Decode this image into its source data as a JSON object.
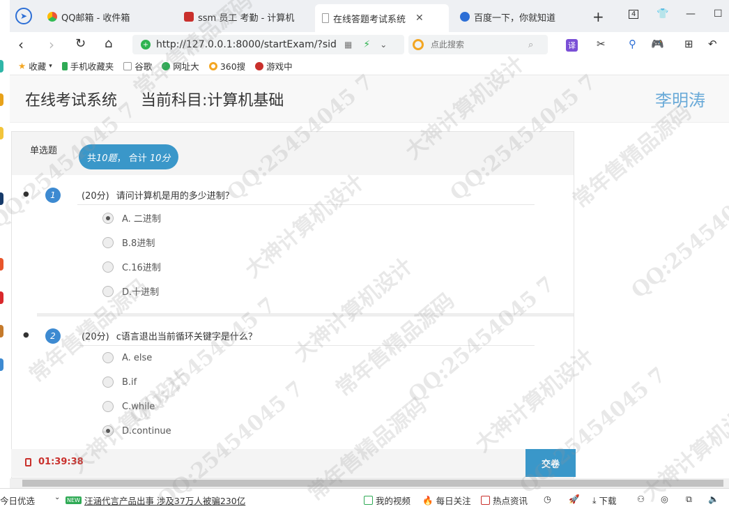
{
  "browser": {
    "tabs": [
      {
        "label": "QQ邮箱 - 收件箱",
        "active": false
      },
      {
        "label": "ssm 员工 考勤 - 计算机",
        "active": false
      },
      {
        "label": "在线答题考试系统",
        "active": true
      },
      {
        "label": "百度一下，你就知道",
        "active": false
      }
    ],
    "tab_count": "4",
    "url": "http://127.0.0.1:8000/startExam/?sid=9",
    "search_placeholder": "点此搜索",
    "translate_label": "译",
    "bookmarks": [
      "收藏",
      "手机收藏夹",
      "谷歌",
      "网址大",
      "360搜",
      "游戏中"
    ]
  },
  "header": {
    "title": "在线考试系统",
    "subject": "当前科目:计算机基础",
    "user": "李明涛"
  },
  "section": {
    "type": "单选题",
    "summary_prefix": "共",
    "question_count": "10题",
    "summary_mid": "， 合计",
    "total_score": "10分"
  },
  "questions": [
    {
      "number": "1",
      "points": "(20分)",
      "text": "请问计算机是用的多少进制？",
      "options": [
        "A. 二进制",
        "B.8进制",
        "C.16进制",
        "D.十进制"
      ],
      "selected": 0
    },
    {
      "number": "2",
      "points": "(20分)",
      "text": "c语言退出当前循环关键字是什么？",
      "options": [
        "A. else",
        "B.if",
        "C.while",
        "D.continue"
      ],
      "selected": 3
    }
  ],
  "footer": {
    "timer": "01:39:38",
    "submit_label": "交卷"
  },
  "statusbar": {
    "left": "今日优选",
    "new_tag": "NEW",
    "news": "汪涵代言产品出事 涉及37万人被骗230亿",
    "video": "我的视频",
    "follow": "每日关注",
    "hot": "热点资讯",
    "download": "下载"
  },
  "watermark": [
    "常年售精品源码",
    "QQ:25454045 7",
    "大神计算机设计"
  ],
  "colors": {
    "accent": "#3a97c9",
    "number_badge": "#3d8ad1",
    "timer": "#c9302c",
    "user_name": "#6aaad8"
  }
}
